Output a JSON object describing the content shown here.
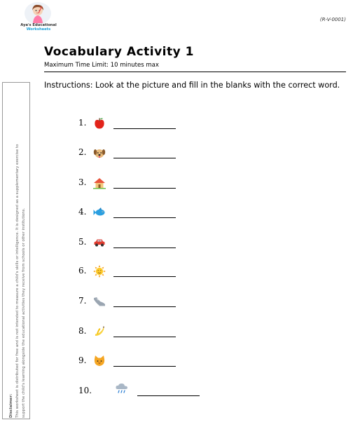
{
  "header": {
    "logo_line1": "Aya's Educational",
    "logo_line2": "Worksheets",
    "code": "(R-V-0001)"
  },
  "title": "Vocabulary Activity 1",
  "subtitle": "Maximum Time Limit: 10 minutes max",
  "instructions": "Instructions: Look at the picture and fill in the blanks with the correct word.",
  "sidebar": {
    "disclaimer_label": "Disclaimer:",
    "disclaimer_line1": "This worksheet is distributed for free and is not intended to measure a child's skills or intelligence. It is designed as a supplementary exercise to",
    "disclaimer_line2": "support the child's learning alongside the educational activities they receive from schools or other institutions."
  },
  "items": [
    {
      "number": "1.",
      "icon": "apple-icon"
    },
    {
      "number": "2.",
      "icon": "dog-icon"
    },
    {
      "number": "3.",
      "icon": "house-icon"
    },
    {
      "number": "4.",
      "icon": "fish-icon"
    },
    {
      "number": "5.",
      "icon": "car-icon"
    },
    {
      "number": "6.",
      "icon": "sun-icon"
    },
    {
      "number": "7.",
      "icon": "shoe-icon"
    },
    {
      "number": "8.",
      "icon": "banana-icon"
    },
    {
      "number": "9.",
      "icon": "cat-icon"
    },
    {
      "number": "10.",
      "icon": "rain-cloud-icon"
    }
  ]
}
